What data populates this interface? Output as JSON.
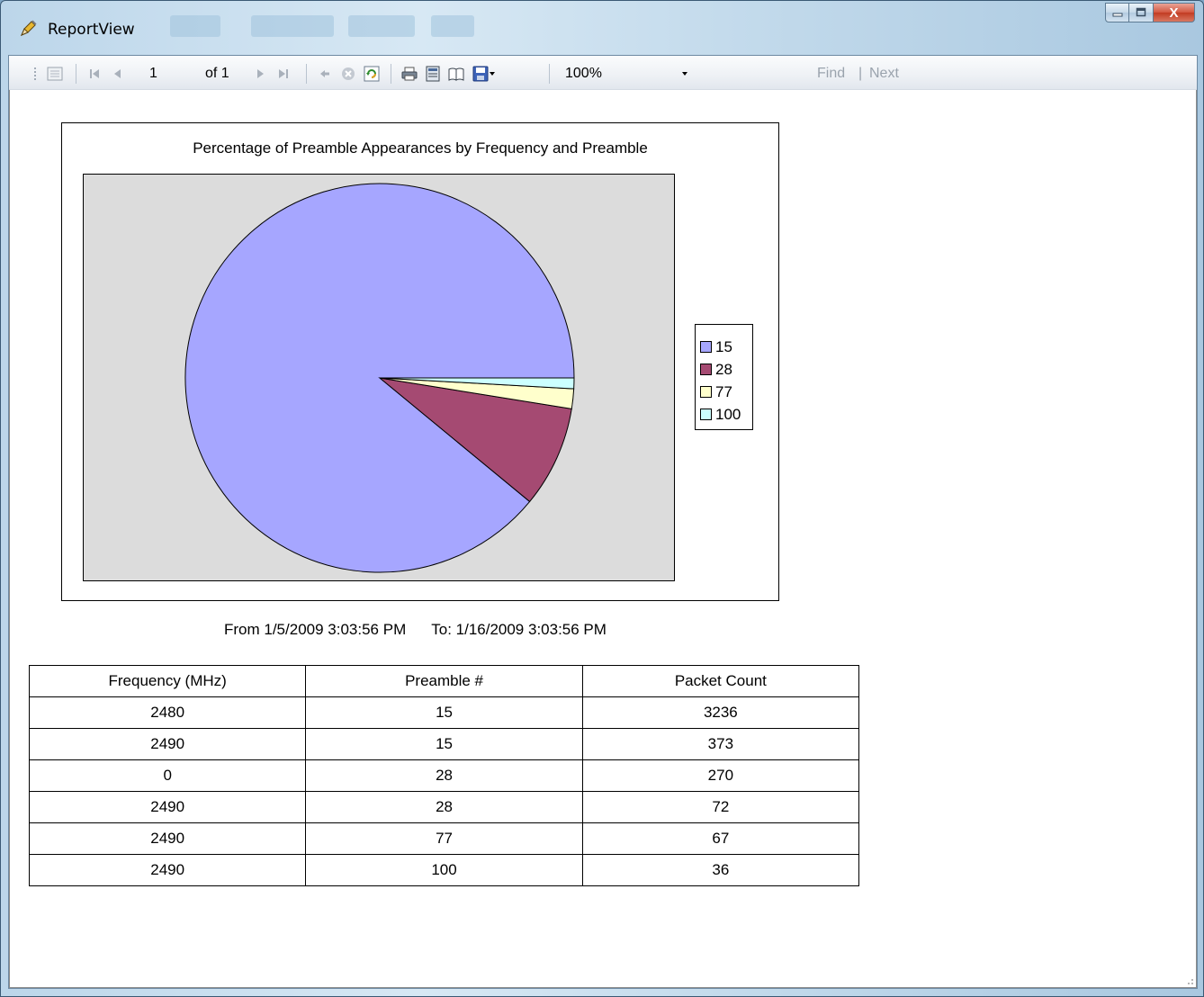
{
  "window": {
    "title": "ReportView",
    "close_glyph": "X"
  },
  "toolbar": {
    "current_page": "1",
    "page_of": "of 1",
    "zoom": "100%",
    "find_label": "Find",
    "separator": "|",
    "next_label": "Next"
  },
  "icons": {
    "app": "pencil-icon",
    "document_map": "document-map-icon",
    "first_page": "first-page-icon",
    "previous_page": "previous-page-icon",
    "next_page": "next-page-icon",
    "last_page": "last-page-icon",
    "back": "back-icon",
    "stop": "stop-icon",
    "refresh": "refresh-icon",
    "print": "print-icon",
    "print_layout": "print-layout-icon",
    "page_setup": "page-setup-icon",
    "export": "save-export-icon",
    "dropdown": "chevron-down-icon"
  },
  "chart_data": {
    "type": "pie",
    "title": "Percentage of Preamble Appearances by Frequency and Preamble",
    "categories": [
      "15",
      "28",
      "77",
      "100"
    ],
    "values": [
      3609,
      342,
      67,
      36
    ],
    "colors": [
      "#a6a6ff",
      "#a54a72",
      "#ffffcc",
      "#ccffff"
    ],
    "start_angle_deg": 0,
    "direction": "counterclockwise",
    "legend": "right",
    "plot_background": "#dcdcdc"
  },
  "report": {
    "from_text": "From 1/5/2009 3:03:56 PM",
    "to_text": "To: 1/16/2009 3:03:56 PM",
    "table": {
      "headers": [
        "Frequency (MHz)",
        "Preamble #",
        "Packet Count"
      ],
      "rows": [
        [
          "2480",
          "15",
          "3236"
        ],
        [
          "2490",
          "15",
          "373"
        ],
        [
          "0",
          "28",
          "270"
        ],
        [
          "2490",
          "28",
          "72"
        ],
        [
          "2490",
          "77",
          "67"
        ],
        [
          "2490",
          "100",
          "36"
        ]
      ]
    }
  }
}
